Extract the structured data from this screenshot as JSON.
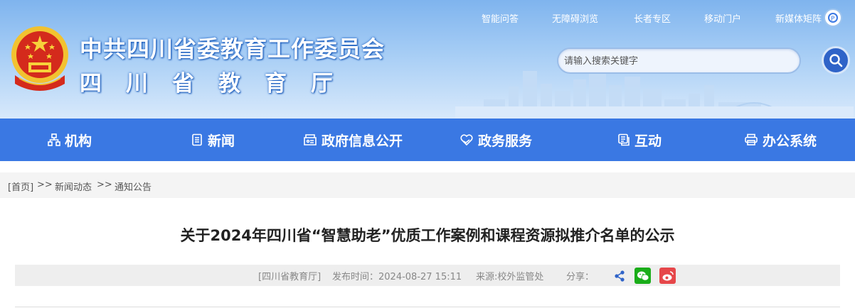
{
  "header": {
    "title": "中共四川省委教育工作委员会",
    "subtitle": "四川省教育厅",
    "top_links": [
      "智能问答",
      "无障碍浏览",
      "长者专区",
      "移动门户",
      "新媒体矩阵"
    ],
    "search": {
      "placeholder": "请输入搜索关键字",
      "value": ""
    }
  },
  "nav": {
    "items": [
      {
        "label": "机构",
        "icon": "org-chart-icon"
      },
      {
        "label": "新闻",
        "icon": "news-icon"
      },
      {
        "label": "政府信息公开",
        "icon": "open-info-icon"
      },
      {
        "label": "政务服务",
        "icon": "heart-hand-icon"
      },
      {
        "label": "互动",
        "icon": "chat-icon"
      },
      {
        "label": "办公系统",
        "icon": "printer-icon"
      }
    ]
  },
  "breadcrumb": {
    "home": "[首页]",
    "separator": ">>",
    "news": "新闻动态",
    "notice": "通知公告"
  },
  "article": {
    "title": "关于2024年四川省“智慧助老”优质工作案例和课程资源拟推介名单的公示",
    "meta": {
      "source": "[四川省教育厅]",
      "time": "发布时间：2024-08-27 15:11",
      "origin": "来源:校外监管处",
      "share_label": "分享："
    },
    "share": [
      "share-icon",
      "wechat-icon",
      "weibo-icon"
    ]
  },
  "colors": {
    "nav_bg": "#3a78e3",
    "search_button": "#2f63c8",
    "wechat": "#1aad19",
    "weibo": "#e6474a",
    "share": "#2f63c8"
  }
}
